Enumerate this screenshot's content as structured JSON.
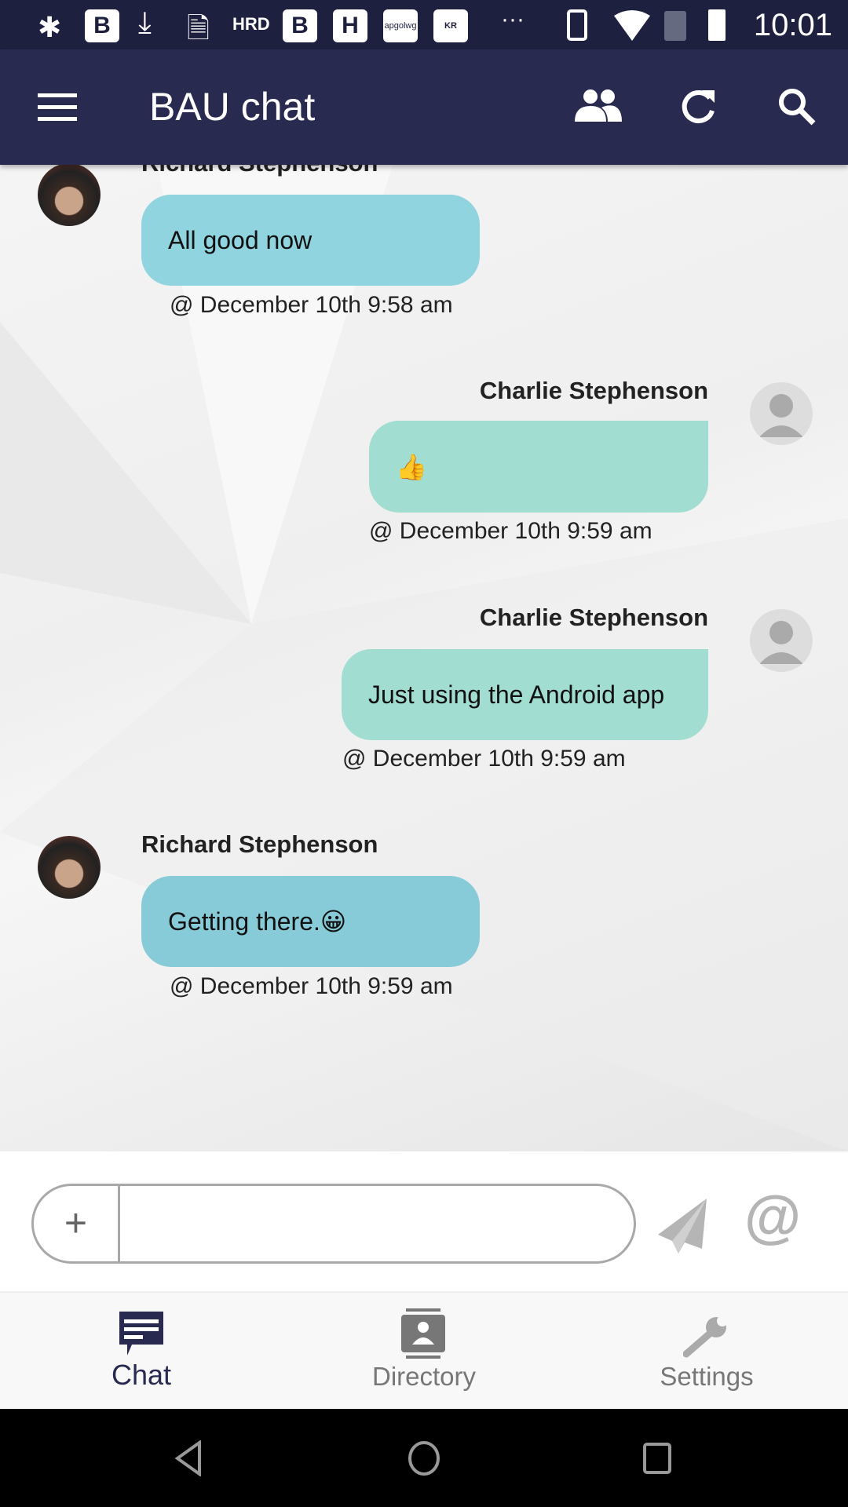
{
  "status_bar": {
    "time": "10:01",
    "notification_icons": [
      "slack-icon",
      "b-app-icon",
      "download-icon",
      "invoice-icon",
      "hrd-icon",
      "b-app-icon",
      "h-app-icon",
      "apgolwg-icon",
      "kiroo-icon",
      "more-icon"
    ],
    "system_icons": [
      "vibrate-icon",
      "wifi-icon",
      "no-sim-icon",
      "battery-icon"
    ]
  },
  "header": {
    "title": "BAU chat",
    "icons": [
      "menu-icon",
      "people-icon",
      "refresh-icon",
      "search-icon"
    ],
    "color": "#282a50"
  },
  "messages": [
    {
      "sender": "Richard Stephenson",
      "text": "All good now",
      "timestamp": "@ December 10th 9:58 am",
      "side": "left",
      "color": "#8fd4de"
    },
    {
      "sender": "Charlie Stephenson",
      "text": "👍",
      "timestamp": "@ December 10th 9:59 am",
      "side": "right",
      "color": "#a2ddd2"
    },
    {
      "sender": "Charlie Stephenson",
      "text": "Just using the Android app",
      "timestamp": "@ December 10th 9:59 am",
      "side": "right",
      "color": "#a2ddd2"
    },
    {
      "sender": "Richard Stephenson",
      "text": "Getting there.😀",
      "timestamp": "@ December 10th 9:59 am",
      "side": "left",
      "color": "#88cbd8"
    }
  ],
  "composer": {
    "value": "",
    "placeholder": "",
    "attach_icon": "plus-icon",
    "send_icon": "send-icon",
    "mention_icon": "at-icon"
  },
  "bottom_nav": {
    "tabs": [
      {
        "label": "Chat",
        "active": true
      },
      {
        "label": "Directory",
        "active": false
      },
      {
        "label": "Settings",
        "active": false
      }
    ],
    "active_color": "#282a50"
  }
}
